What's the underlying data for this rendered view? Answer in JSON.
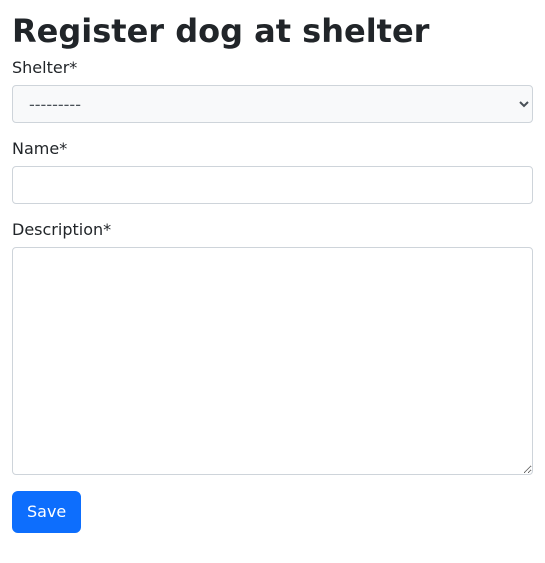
{
  "page": {
    "title": "Register dog at shelter"
  },
  "form": {
    "shelter": {
      "label": "Shelter*",
      "selected": "---------"
    },
    "name": {
      "label": "Name*",
      "value": ""
    },
    "description": {
      "label": "Description*",
      "value": ""
    },
    "submit_label": "Save"
  }
}
